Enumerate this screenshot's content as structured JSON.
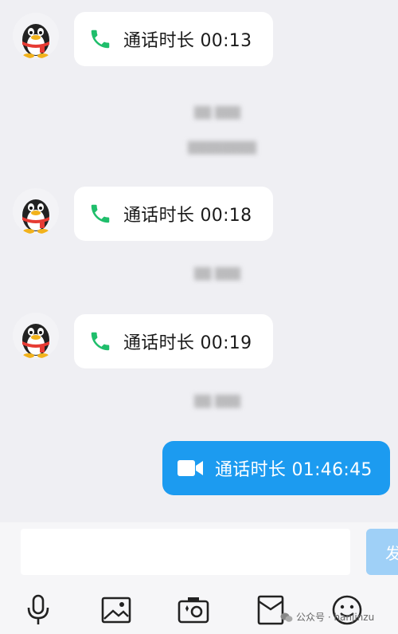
{
  "messages": [
    {
      "direction": "in",
      "icon": "phone-icon",
      "text": "通话时长 00:13"
    },
    {
      "direction": "in",
      "icon": "phone-icon",
      "text": "通话时长 00:18"
    },
    {
      "direction": "in",
      "icon": "phone-icon",
      "text": "通话时长 00:19"
    },
    {
      "direction": "out",
      "icon": "video-call-icon",
      "text": "通话时长 01:46:45"
    }
  ],
  "composer": {
    "input_value": "",
    "send_label": "发"
  },
  "toolbar": [
    "microphone-icon",
    "image-icon",
    "camera-icon",
    "red-packet-icon",
    "emoji-icon"
  ],
  "watermark": {
    "text": "公众号 · hanjinzu"
  },
  "colors": {
    "outgoing_bubble": "#1c9bf0",
    "call_icon_green": "#1fbe6b",
    "background": "#efeff3"
  }
}
